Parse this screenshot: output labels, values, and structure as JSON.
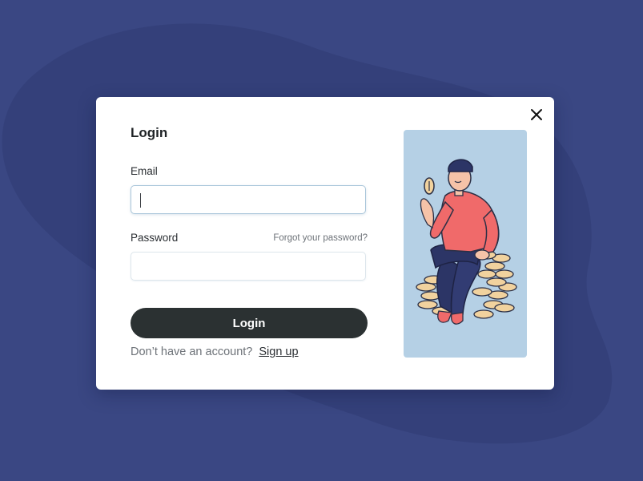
{
  "modal": {
    "title": "Login",
    "email": {
      "label": "Email",
      "value": ""
    },
    "password": {
      "label": "Password",
      "value": "",
      "forgot_label": "Forgot your password?"
    },
    "login_button_label": "Login",
    "signup": {
      "prompt": "Don’t have an account?",
      "link_label": "Sign up"
    }
  },
  "icons": {
    "close": "close-icon",
    "illustration": "person-sitting-on-coins-illustration"
  },
  "colors": {
    "page_background": "#3a4783",
    "modal_background": "#ffffff",
    "button_background": "#2b3132",
    "illustration_background": "#b5d0e5",
    "accent_shirt": "#f06a6a"
  }
}
